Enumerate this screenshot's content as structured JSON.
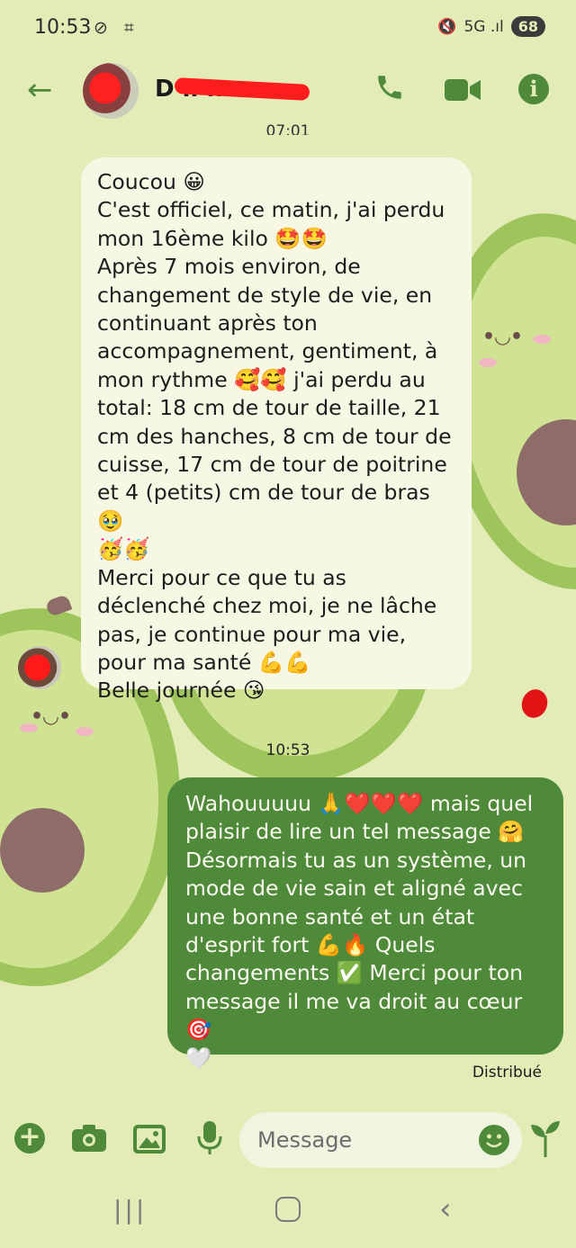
{
  "status_bar": {
    "time": "10:53",
    "left_icons": "⊘ ⌗",
    "signal": "5G .ıl",
    "battery": "68"
  },
  "header": {
    "contact_name": "D        ll   n",
    "previous_time_partial": "07:01",
    "icons": [
      "back-arrow-icon",
      "avatar",
      "phone-icon",
      "video-icon",
      "info-icon"
    ]
  },
  "incoming_message": {
    "text": "Coucou 😀\nC'est officiel, ce matin, j'ai perdu mon 16ème kilo 🤩🤩\nAprès 7 mois environ, de changement de style de vie, en continuant après ton accompagnement, gentiment, à mon rythme 🥰🥰 j'ai perdu au total: 18 cm de tour de taille, 21 cm des hanches, 8 cm de tour de cuisse, 17 cm de tour de poitrine et 4 (petits) cm de tour de bras 🥹\n🥳🥳\nMerci pour ce que tu as déclenché chez moi, je ne lâche pas, je continue pour ma vie, pour ma santé 💪💪\nBelle journée 😘"
  },
  "timestamp": "10:53",
  "outgoing_message": {
    "text": "Wahouuuuu 🙏❤️❤️❤️ mais quel plaisir de lire un tel message 🤗 Désormais tu as un système, un mode de vie sain et aligné avec une bonne santé et un état d'esprit fort 💪🔥 Quels changements ✅ Merci pour ton message il me va droit au cœur 🎯\n🤍"
  },
  "delivery_status": "Distribué",
  "composer": {
    "placeholder": "Message",
    "icons": [
      "add-icon",
      "camera-icon",
      "gallery-icon",
      "mic-icon",
      "emoji-icon",
      "sprout-icon"
    ]
  },
  "colors": {
    "background": "#e3ebb7",
    "accent": "#4f8a3b",
    "incoming_bubble": "#f6f8e3",
    "outgoing_bubble": "#4e8a39"
  }
}
